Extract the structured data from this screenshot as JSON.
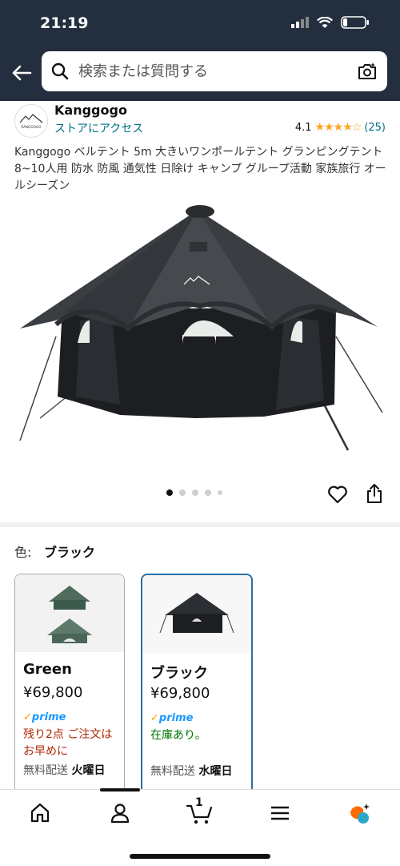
{
  "status_bar": {
    "time": "21:19"
  },
  "search": {
    "placeholder": "検索または質問する"
  },
  "brand": {
    "logo_text": "KANGGOGO",
    "name": "Kanggogo",
    "store_link": "ストアにアクセス"
  },
  "rating": {
    "value": "4.1",
    "stars": "★★★★☆",
    "count": "(25)"
  },
  "product": {
    "title": "Kanggogo ベルテント 5m 大きいワンポールテント グランピングテント8~10人用 防水 防風 通気性 日除け キャンプ グループ活動 家族旅行 オールシーズン"
  },
  "carousel": {
    "total": 5,
    "active": 1
  },
  "color_selector": {
    "label": "色:",
    "value": "ブラック"
  },
  "variants": [
    {
      "name": "Green",
      "price": "¥69,800",
      "prime": "prime",
      "stock": "残り2点 ご注文はお早めに",
      "shipping": "無料配送",
      "shipping_day": "火曜日",
      "selected": false
    },
    {
      "name": "ブラック",
      "price": "¥69,800",
      "prime": "prime",
      "stock": "在庫あり。",
      "shipping": "無料配送",
      "shipping_day": "水曜日",
      "selected": true
    }
  ],
  "bottom_nav": {
    "cart_count": "1",
    "items": [
      "home-icon",
      "account-icon",
      "cart-icon",
      "menu-icon",
      "rufus-icon"
    ]
  },
  "colors": {
    "header": "#232f3e",
    "link": "#007185",
    "star": "#ffa41c",
    "selected_border": "#2a6ea6",
    "low_stock": "#b12704",
    "in_stock": "#007600",
    "prime": "#1a98ff"
  }
}
